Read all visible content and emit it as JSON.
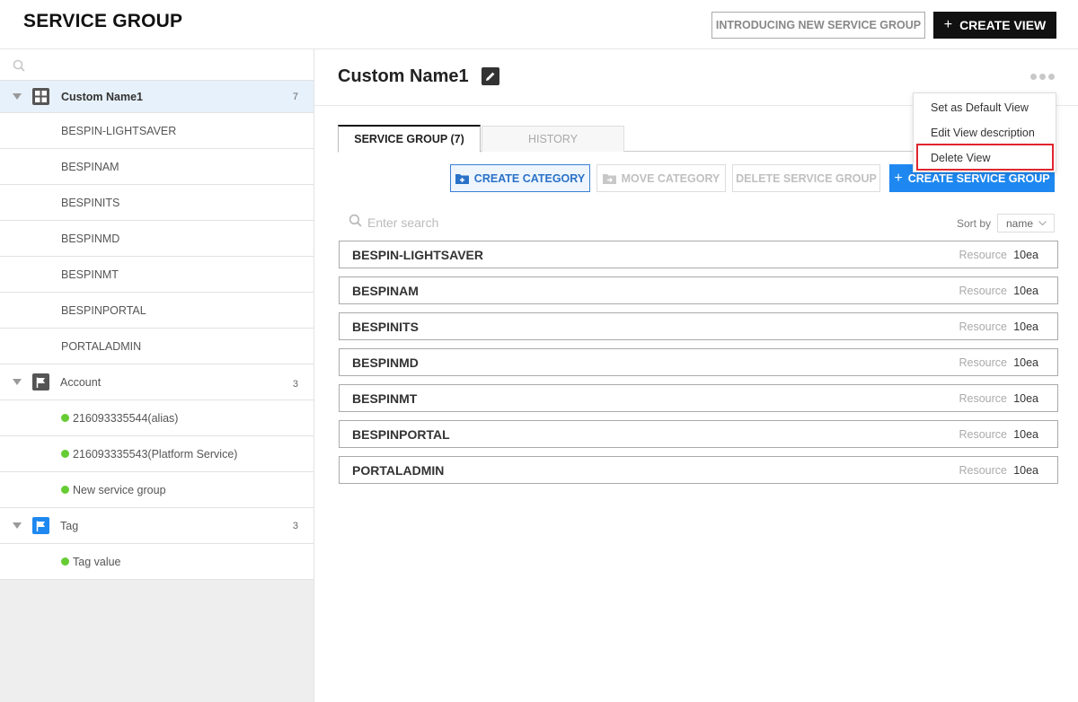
{
  "header": {
    "title": "SERVICE GROUP",
    "intro_button": "INTRODUCING NEW SERVICE GROUP",
    "create_view_button": "CREATE VIEW"
  },
  "sidebar": {
    "groups": [
      {
        "label": "Custom Name1",
        "count": "7",
        "icon": "grid-icon"
      },
      {
        "label": "Account",
        "count": "3",
        "icon": "flag-icon"
      },
      {
        "label": "Tag",
        "count": "3",
        "icon": "tag-flag-icon"
      }
    ],
    "custom_items": [
      "BESPIN-LIGHTSAVER",
      "BESPINAM",
      "BESPINITS",
      "BESPINMD",
      "BESPINMT",
      "BESPINPORTAL",
      "PORTALADMIN"
    ],
    "account_items": [
      "216093335544(alias)",
      "216093335543(Platform Service)",
      "New service group"
    ],
    "tag_items": [
      "Tag value"
    ]
  },
  "main": {
    "view_title": "Custom Name1",
    "tabs": [
      "SERVICE GROUP (7)",
      "HISTORY"
    ],
    "actions": {
      "create_category": "CREATE CATEGORY",
      "move_category": "MOVE CATEGORY",
      "delete_service_group": "DELETE SERVICE GROUP",
      "create_service_group": "CREATE SERVICE GROUP"
    },
    "search": {
      "placeholder": "Enter search",
      "value": ""
    },
    "sort": {
      "label": "Sort by",
      "selected": "name"
    },
    "resource_label": "Resource",
    "service_groups": [
      {
        "name": "BESPIN-LIGHTSAVER",
        "resource": "10ea"
      },
      {
        "name": "BESPINAM",
        "resource": "10ea"
      },
      {
        "name": "BESPINITS",
        "resource": "10ea"
      },
      {
        "name": "BESPINMD",
        "resource": "10ea"
      },
      {
        "name": "BESPINMT",
        "resource": "10ea"
      },
      {
        "name": "BESPINPORTAL",
        "resource": "10ea"
      },
      {
        "name": "PORTALADMIN",
        "resource": "10ea"
      }
    ]
  },
  "dropdown": {
    "items": [
      "Set as Default View",
      "Edit View description",
      "Delete View"
    ],
    "highlighted": "Delete View"
  },
  "colors": {
    "accent_blue": "#1e88f0",
    "status_green": "#66cc33",
    "highlight_red": "#e0262f",
    "active_row_bg": "#e7f1fb"
  }
}
